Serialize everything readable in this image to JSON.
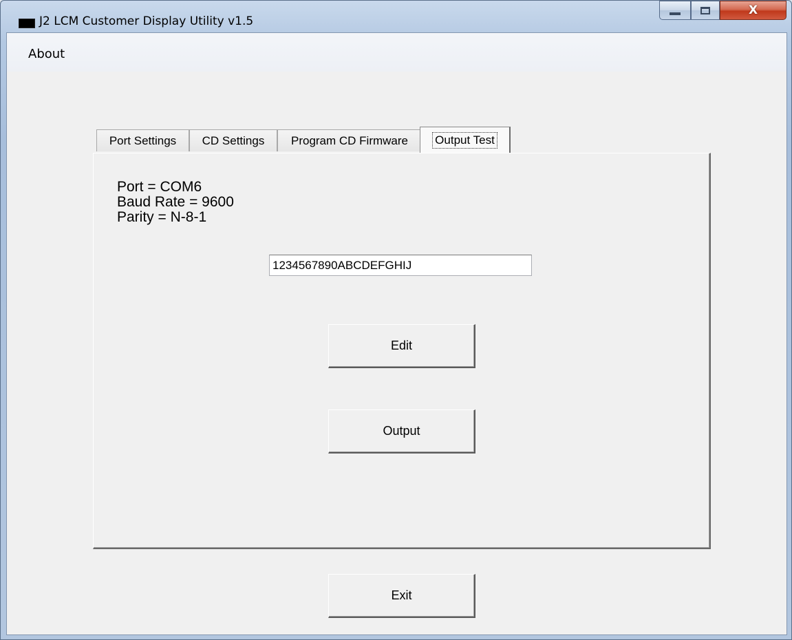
{
  "window": {
    "title": "J2 LCM Customer Display Utility v1.5",
    "icon": "app-icon",
    "controls": {
      "minimize_icon": "minimize-icon",
      "maximize_icon": "maximize-icon",
      "close_symbol": "X"
    }
  },
  "menu": {
    "items": [
      {
        "label": "About"
      }
    ]
  },
  "tabs": [
    {
      "label": "Port Settings",
      "active": false
    },
    {
      "label": "CD Settings",
      "active": false
    },
    {
      "label": "Program CD Firmware",
      "active": false
    },
    {
      "label": "Output Test",
      "active": true
    }
  ],
  "output_test": {
    "port_line": "Port = COM6",
    "baud_line": "Baud Rate = 9600",
    "parity_line": "Parity = N-8-1",
    "test_string": "1234567890ABCDEFGHIJ",
    "edit_label": "Edit",
    "output_label": "Output"
  },
  "footer": {
    "exit_label": "Exit"
  },
  "colors": {
    "close_button": "#c0391c",
    "client_background": "#f0f0f0",
    "frame": "#a7bedb"
  }
}
